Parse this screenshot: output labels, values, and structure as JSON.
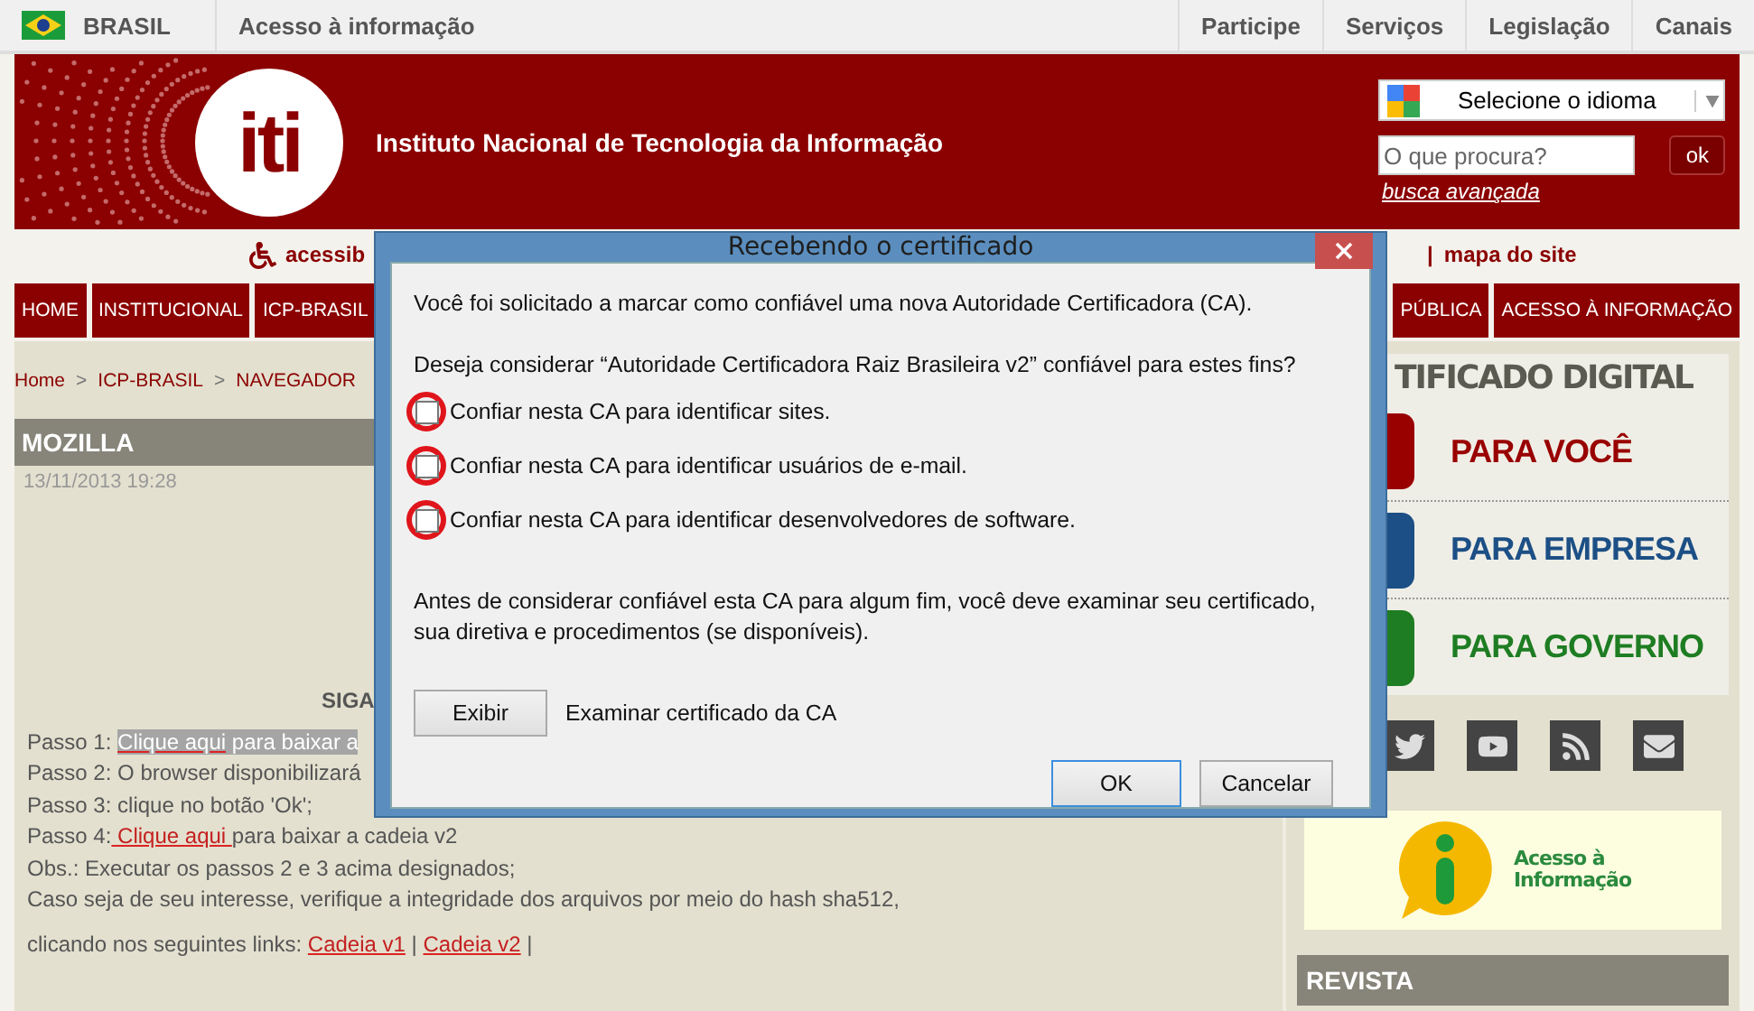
{
  "top_bar": {
    "country": "BRASIL",
    "link": "Acesso à informação",
    "menu": [
      "Participe",
      "Serviços",
      "Legislação",
      "Canais"
    ]
  },
  "header": {
    "logo_text": "iti",
    "title": "Instituto Nacional de Tecnologia da Informação",
    "language_select": "Selecione o idioma",
    "search": {
      "placeholder": "O que procura?"
    },
    "search_button": "ok",
    "advanced_search": "busca avançada"
  },
  "access_bar": {
    "accessibility": "acessib",
    "separator": "|",
    "site_map": "mapa do site"
  },
  "nav": {
    "left": [
      "HOME",
      "INSTITUCIONAL",
      "ICP-BRASIL"
    ],
    "right": [
      "PÚBLICA",
      "ACESSO À INFORMAÇÃO"
    ]
  },
  "breadcrumb": [
    "Home",
    "ICP-BRASIL",
    "NAVEGADOR"
  ],
  "breadcrumb_separators": [
    ">",
    ">"
  ],
  "article": {
    "title": "MOZILLA",
    "date": "13/11/2013 19:28",
    "heading": "SIGA",
    "lines": [
      [
        {
          "text": "Passo 1: ",
          "link": false,
          "selected": false
        },
        {
          "text": "Clique aqui",
          "link": true,
          "selected": true
        },
        {
          "text": " para baixar a",
          "link": false,
          "selected": true
        }
      ],
      [
        {
          "text": "Passo 2: O browser disponibilizará",
          "link": false,
          "selected": false
        }
      ],
      [
        {
          "text": "Passo 3: clique no botão 'Ok';",
          "link": false,
          "selected": false
        }
      ],
      [
        {
          "text": "Passo 4:",
          "link": false,
          "selected": false
        },
        {
          "text": " Clique aqui ",
          "link": true,
          "selected": false
        },
        {
          "text": "para baixar a cadeia v2",
          "link": false,
          "selected": false
        }
      ],
      [
        {
          "text": "Obs.: Executar os passos 2 e 3 acima designados;",
          "link": false,
          "selected": false
        }
      ],
      [
        {
          "text": "Caso seja de seu interesse, verifique a integridade dos arquivos por meio do hash sha512,",
          "link": false,
          "selected": false
        }
      ]
    ],
    "links_line": [
      {
        "text": "clicando nos seguintes links: ",
        "link": false,
        "selected": false
      },
      {
        "text": "Cadeia v1",
        "link": true,
        "selected": false
      },
      {
        "text": " | ",
        "link": false,
        "selected": false
      },
      {
        "text": "Cadeia v2",
        "link": true,
        "selected": false
      },
      {
        "text": " |",
        "link": false,
        "selected": false
      }
    ]
  },
  "sidebar": {
    "heading": "TIFICADO DIGITAL",
    "options": [
      {
        "label": "PARA VOCÊ",
        "color": "#990000"
      },
      {
        "label": "PARA EMPRESA",
        "color": "#1c4f85"
      },
      {
        "label": "PARA GOVERNO",
        "color": "#1e7d22"
      }
    ],
    "banner": [
      "Acesso à",
      "Informação"
    ],
    "section": "REVISTA"
  },
  "dialog": {
    "title": "Recebendo o certificado",
    "intro": "Você foi solicitado a marcar como confiável uma nova Autoridade Certificadora (CA).",
    "question": "Deseja considerar “Autoridade Certificadora Raiz Brasileira v2” confiável para estes fins?",
    "options": [
      {
        "label": "Confiar nesta CA para identificar sites.",
        "checked": false
      },
      {
        "label": "Confiar nesta CA para identificar usuários de e-mail.",
        "checked": false
      },
      {
        "label": "Confiar nesta CA para identificar desenvolvedores de software.",
        "checked": false
      }
    ],
    "note": "Antes de considerar confiável esta CA para algum fim, você deve examinar seu certificado, sua diretiva e procedimentos (se disponíveis).",
    "view_button": "Exibir",
    "view_label": "Examinar certificado da CA",
    "ok_button": "OK",
    "cancel_button": "Cancelar"
  }
}
